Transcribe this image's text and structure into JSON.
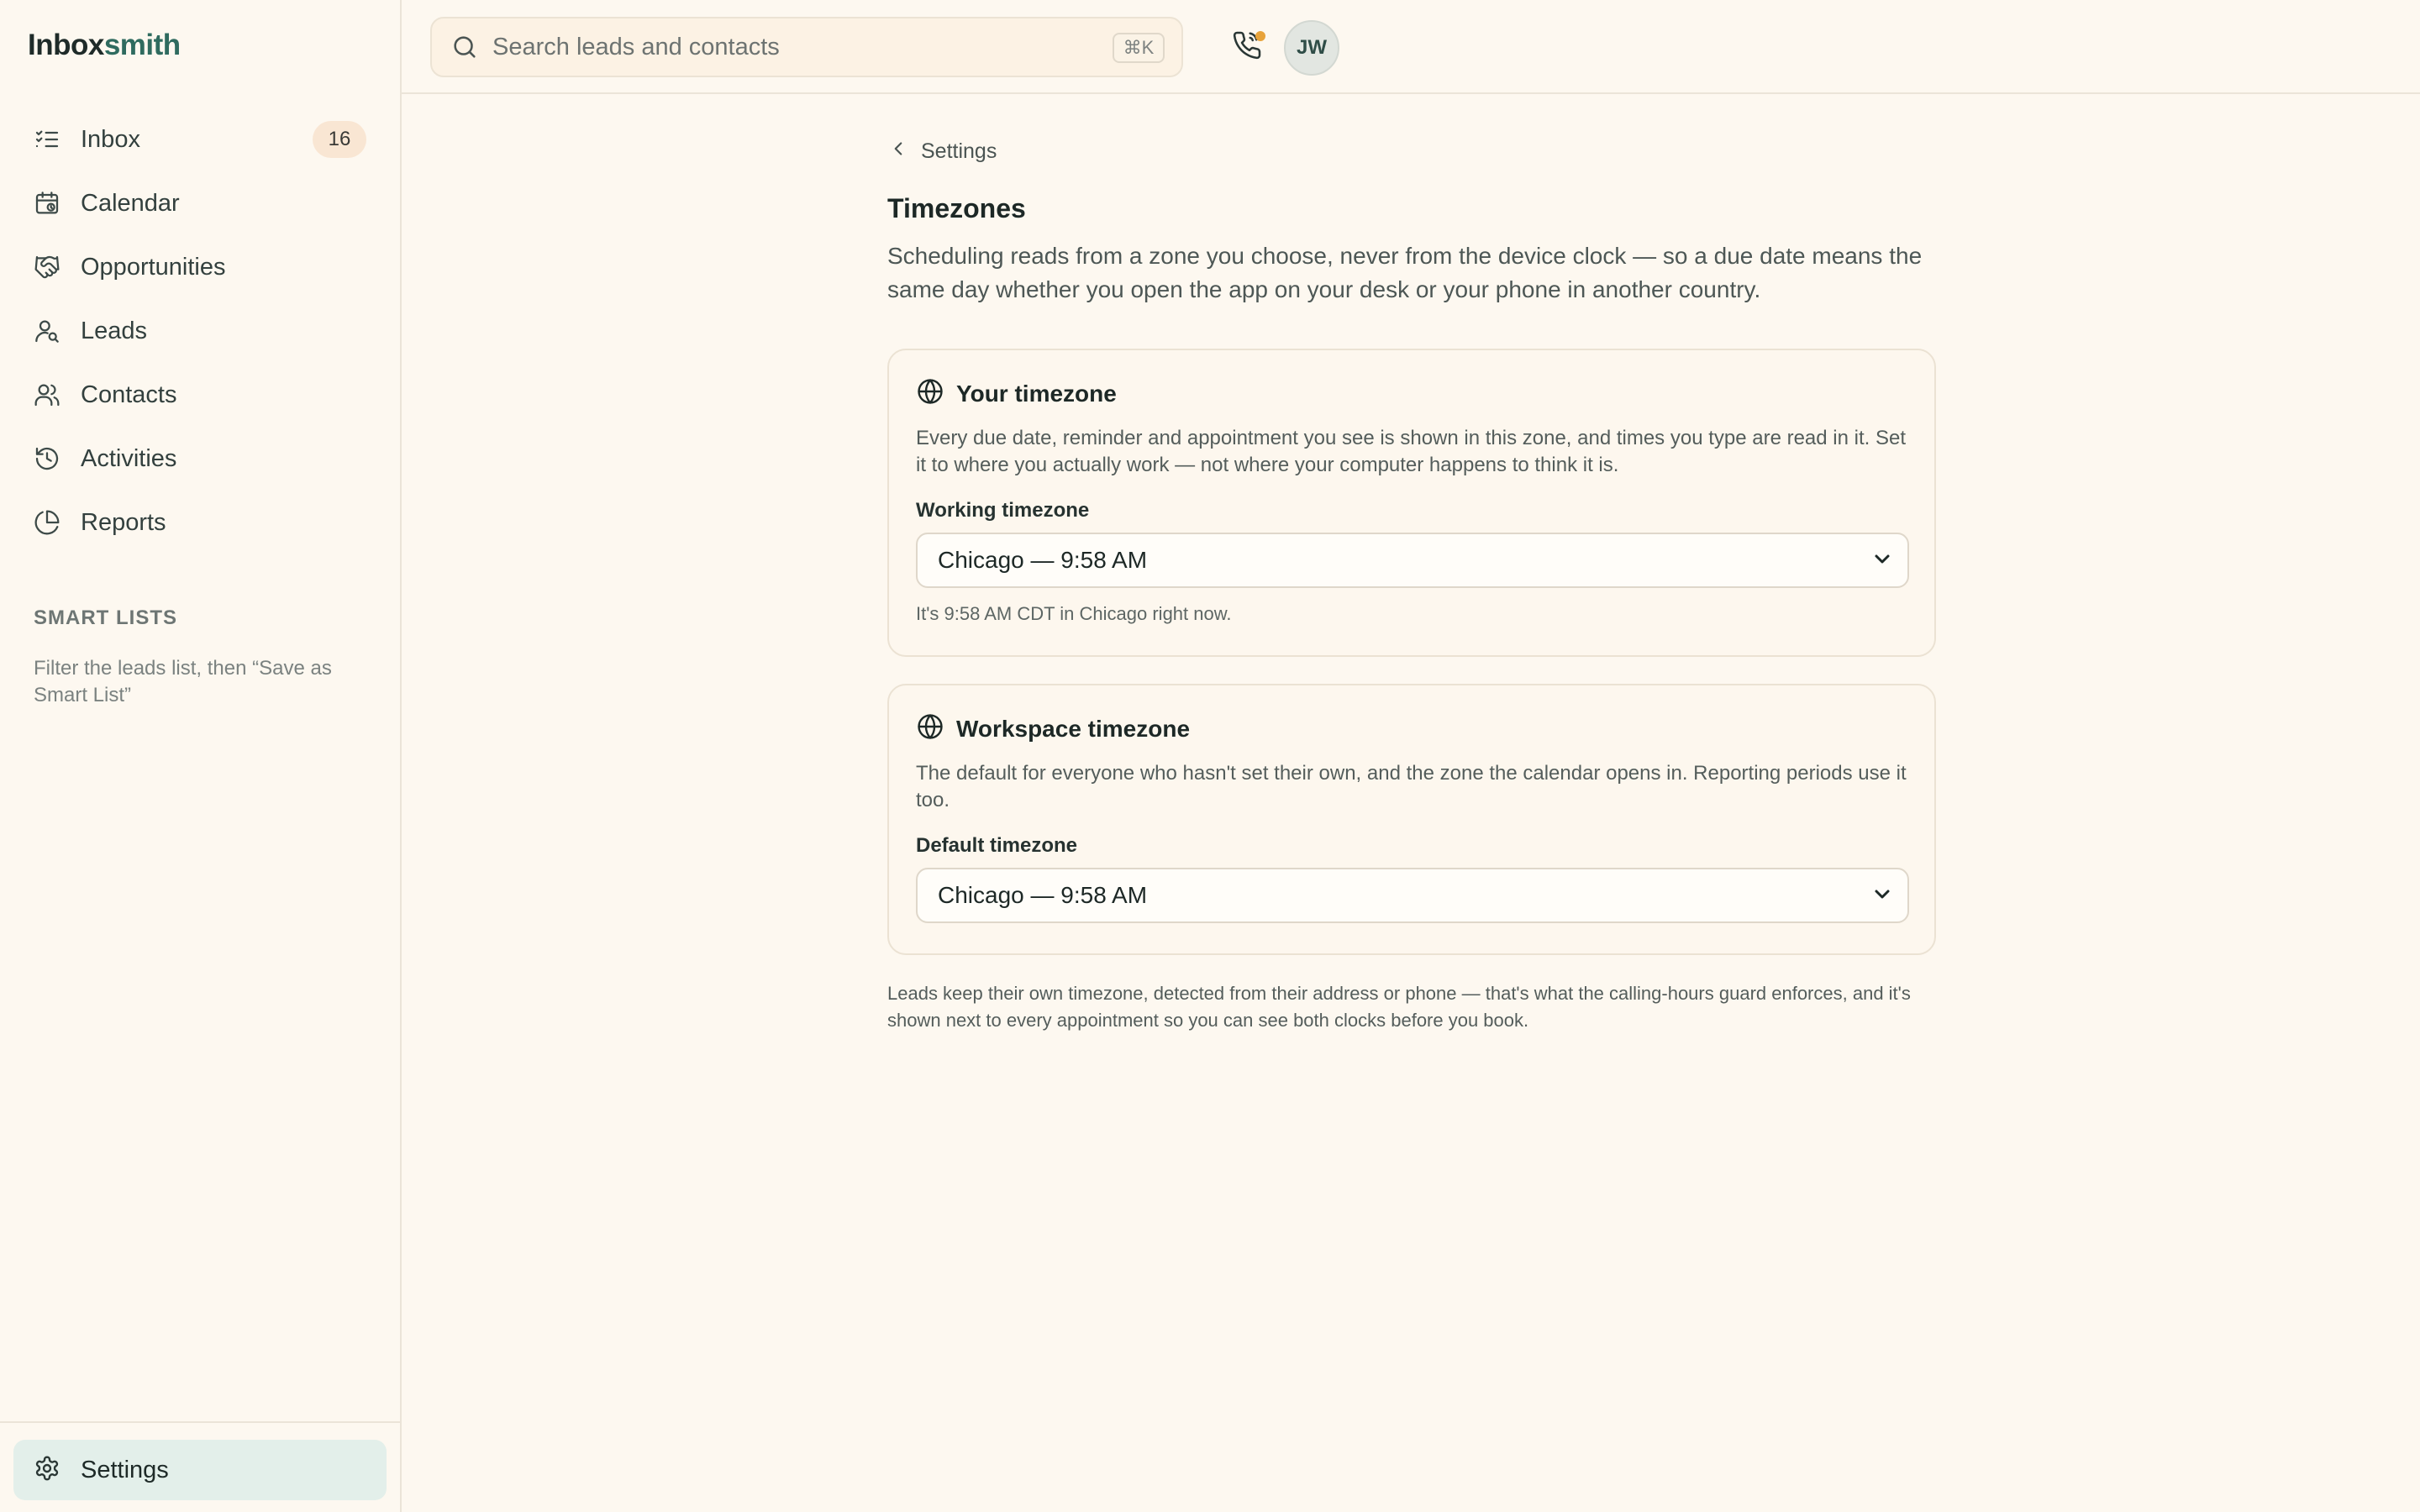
{
  "brand": {
    "part1": "Inbox",
    "part2": "smith"
  },
  "sidebar": {
    "items": [
      {
        "label": "Inbox",
        "icon": "list-check-icon",
        "badge": "16"
      },
      {
        "label": "Calendar",
        "icon": "calendar-icon"
      },
      {
        "label": "Opportunities",
        "icon": "handshake-icon"
      },
      {
        "label": "Leads",
        "icon": "user-search-icon"
      },
      {
        "label": "Contacts",
        "icon": "users-icon"
      },
      {
        "label": "Activities",
        "icon": "history-icon"
      },
      {
        "label": "Reports",
        "icon": "pie-chart-icon"
      }
    ],
    "smart_lists": {
      "title": "SMART LISTS",
      "hint": "Filter the leads list, then “Save as Smart List”"
    },
    "settings_label": "Settings"
  },
  "topbar": {
    "search_placeholder": "Search leads and contacts",
    "shortcut": "⌘K",
    "avatar_initials": "JW"
  },
  "main": {
    "breadcrumb": "Settings",
    "title": "Timezones",
    "description": "Scheduling reads from a zone you choose, never from the device clock — so a due date means the same day whether you open the app on your desk or your phone in another country.",
    "your_timezone": {
      "title": "Your timezone",
      "description": "Every due date, reminder and appointment you see is shown in this zone, and times you type are read in it. Set it to where you actually work — not where your computer happens to think it is.",
      "field_label": "Working timezone",
      "selected": "Chicago — 9:58 AM",
      "help": "It's 9:58 AM CDT in Chicago right now."
    },
    "workspace_timezone": {
      "title": "Workspace timezone",
      "description": "The default for everyone who hasn't set their own, and the zone the calendar opens in. Reporting periods use it too.",
      "field_label": "Default timezone",
      "selected": "Chicago — 9:58 AM"
    },
    "footnote": "Leads keep their own timezone, detected from their address or phone — that's what the calling-hours guard enforces, and it's shown next to every appointment so you can see both clocks before you book."
  },
  "colors": {
    "background": "#fdf8f0",
    "accent": "#2f6b5f",
    "active_nav": "#e3efea",
    "notification_dot": "#e8a33a"
  }
}
